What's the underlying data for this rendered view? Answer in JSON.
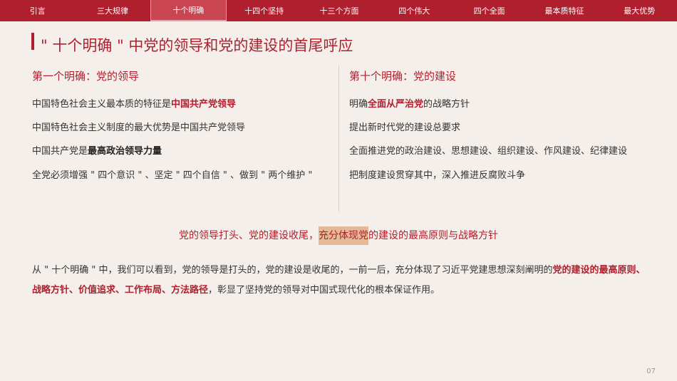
{
  "nav": [
    {
      "label": "引言",
      "active": false
    },
    {
      "label": "三大规律",
      "active": false
    },
    {
      "label": "十个明确",
      "active": true
    },
    {
      "label": "十四个坚持",
      "active": false
    },
    {
      "label": "十三个方面",
      "active": false
    },
    {
      "label": "四个伟大",
      "active": false
    },
    {
      "label": "四个全面",
      "active": false
    },
    {
      "label": "最本质特征",
      "active": false
    },
    {
      "label": "最大优势",
      "active": false
    }
  ],
  "title": "\" 十个明确 \" 中党的领导和党的建设的首尾呼应",
  "left": {
    "title": "第一个明确：党的领导",
    "items": [
      {
        "pre": "中国特色社会主义最本质的特征是",
        "em": "中国共产党领导",
        "post": ""
      },
      {
        "pre": "中国特色社会主义制度的最大优势是中国共产党领导",
        "em": "",
        "post": ""
      },
      {
        "pre": "中国共产党是",
        "em": "最高政治领导力量",
        "post": ""
      },
      {
        "pre": "全党必须增强 \" 四个意识 \" 、坚定 \" 四个自信 \" 、做到 \" 两个维护 \"",
        "em": "",
        "post": ""
      }
    ]
  },
  "right": {
    "title": "第十个明确：党的建设",
    "items": [
      {
        "pre": "明确",
        "em": "全面从严治党",
        "post": "的战略方针"
      },
      {
        "pre": "提出新时代党的建设总要求",
        "em": "",
        "post": ""
      },
      {
        "pre": "全面推进党的政治建设、思想建设、组织建设、作风建设、纪律建设",
        "em": "",
        "post": ""
      },
      {
        "pre": "把制度建设贯穿其中，深入推进反腐败斗争",
        "em": "",
        "post": ""
      }
    ]
  },
  "summary": {
    "pre": "党的领导打头、党的建设收尾，",
    "mark": "充分体现党",
    "post": "的建设的最高原则与战略方针"
  },
  "paragraph": {
    "pre": "从 \" 十个明确 \" 中，我们可以看到，党的领导是打头的，党的建设是收尾的，一前一后，充分体现了习近平党建思想深刻阐明的",
    "em": "党的建设的最高原则、战略方针、价值追求、工作布局、方法路径",
    "post": "，彰显了坚持党的领导对中国式现代化的根本保证作用。"
  },
  "page_number": "07",
  "colors": {
    "accent": "#b01f2e",
    "background": "#f4efea"
  }
}
